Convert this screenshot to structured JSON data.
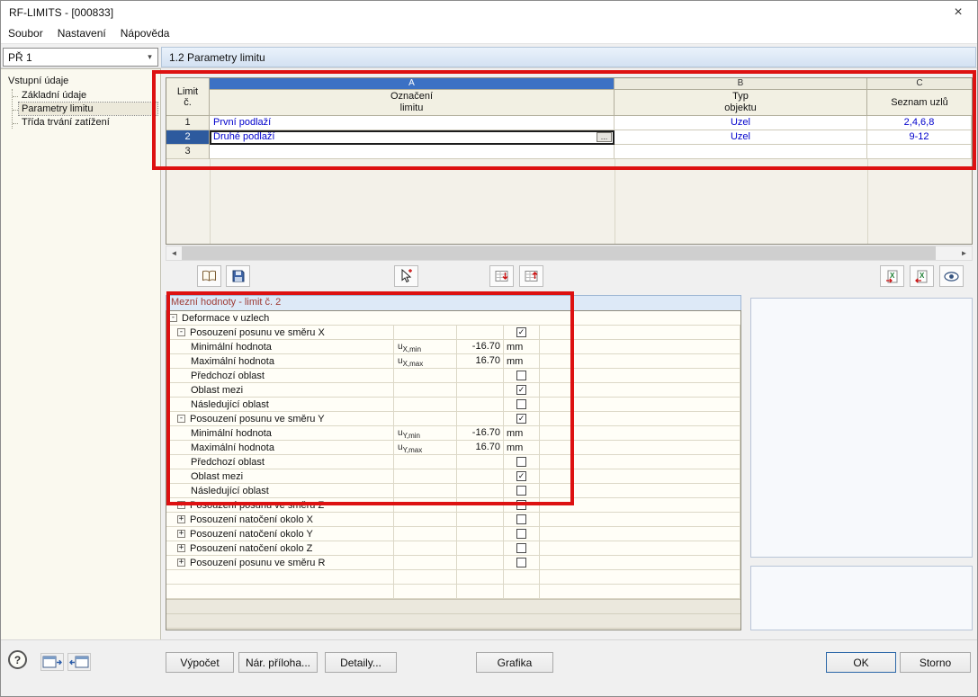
{
  "window": {
    "title": "RF-LIMITS - [000833]",
    "close_glyph": "×"
  },
  "menu": {
    "items": [
      "Soubor",
      "Nastavení",
      "Nápověda"
    ]
  },
  "topbar": {
    "case_selector": "PŘ 1",
    "dropdown_glyph": "▾",
    "section_title": "1.2 Parametry limitu"
  },
  "sidebar": {
    "root_label": "Vstupní údaje",
    "items": [
      {
        "label": "Základní údaje",
        "selected": false
      },
      {
        "label": "Parametry limitu",
        "selected": true
      },
      {
        "label": "Třída trvání zatížení",
        "selected": false
      }
    ]
  },
  "limits_table": {
    "corner_line1": "Limit",
    "corner_line2": "č.",
    "ellipsis_label": "...",
    "columns": [
      {
        "letter": "A",
        "header_line1": "Označení",
        "header_line2": "limitu"
      },
      {
        "letter": "B",
        "header_line1": "Typ",
        "header_line2": "objektu"
      },
      {
        "letter": "C",
        "header_line1": "Seznam uzlů",
        "header_line2": ""
      }
    ],
    "rows": [
      {
        "num": "1",
        "name": "První podlaží",
        "type": "Uzel",
        "nodes": "2,4,6,8",
        "selected": false
      },
      {
        "num": "2",
        "name": "Druhé podlaží",
        "type": "Uzel",
        "nodes": "9-12",
        "selected": true
      },
      {
        "num": "3",
        "name": "",
        "type": "",
        "nodes": "",
        "selected": false
      }
    ]
  },
  "scrollbar": {
    "left_glyph": "◄",
    "right_glyph": "►"
  },
  "table_toolbar": {
    "icons": [
      "book-icon",
      "save-icon",
      "pick-object-icon",
      "import-rows-icon",
      "export-rows-icon",
      "excel-export-icon",
      "excel-import-icon",
      "visibility-icon"
    ]
  },
  "limit_values": {
    "title": "Mezní hodnoty - limit č. 2",
    "rows": [
      {
        "indent": 0,
        "expander": "-",
        "label": "Deformace v uzlech",
        "group": true
      },
      {
        "indent": 1,
        "expander": "-",
        "label": "Posouzení posunu ve směru X",
        "check": true
      },
      {
        "indent": 2,
        "label": "Minimální hodnota",
        "sym": "u",
        "sub": "X,min",
        "value": "-16.70",
        "unit": "mm"
      },
      {
        "indent": 2,
        "label": "Maximální hodnota",
        "sym": "u",
        "sub": "X,max",
        "value": "16.70",
        "unit": "mm"
      },
      {
        "indent": 2,
        "label": "Předchozí oblast",
        "check": false
      },
      {
        "indent": 2,
        "label": "Oblast mezi",
        "check": true
      },
      {
        "indent": 2,
        "label": "Následující oblast",
        "check": false
      },
      {
        "indent": 1,
        "expander": "-",
        "label": "Posouzení posunu ve směru Y",
        "check": true
      },
      {
        "indent": 2,
        "label": "Minimální hodnota",
        "sym": "u",
        "sub": "Y,min",
        "value": "-16.70",
        "unit": "mm"
      },
      {
        "indent": 2,
        "label": "Maximální hodnota",
        "sym": "u",
        "sub": "Y,max",
        "value": "16.70",
        "unit": "mm"
      },
      {
        "indent": 2,
        "label": "Předchozí oblast",
        "check": false
      },
      {
        "indent": 2,
        "label": "Oblast mezi",
        "check": true
      },
      {
        "indent": 2,
        "label": "Následující oblast",
        "check": false
      },
      {
        "indent": 1,
        "expander": "+",
        "label": "Posouzení posunu ve směru Z",
        "check": false
      },
      {
        "indent": 1,
        "expander": "+",
        "label": "Posouzení natočení okolo X",
        "check": false
      },
      {
        "indent": 1,
        "expander": "+",
        "label": "Posouzení natočení okolo Y",
        "check": false
      },
      {
        "indent": 1,
        "expander": "+",
        "label": "Posouzení natočení okolo Z",
        "check": false
      },
      {
        "indent": 1,
        "expander": "+",
        "label": "Posouzení posunu ve směru R",
        "check": false
      },
      {
        "empty": true
      },
      {
        "empty": true
      }
    ]
  },
  "footer": {
    "help_glyph": "?",
    "buttons": {
      "vypocet": "Výpočet",
      "narodni_priloha": "Nár. příloha...",
      "detaily": "Detaily...",
      "grafika": "Grafika",
      "ok": "OK",
      "storno": "Storno"
    }
  },
  "colors": {
    "selected_column": "#3c71c4",
    "selected_row": "#2d5a9e",
    "data_text": "#0000cc",
    "section_title_text": "#9e3b35",
    "annotation": "#dd1111"
  }
}
